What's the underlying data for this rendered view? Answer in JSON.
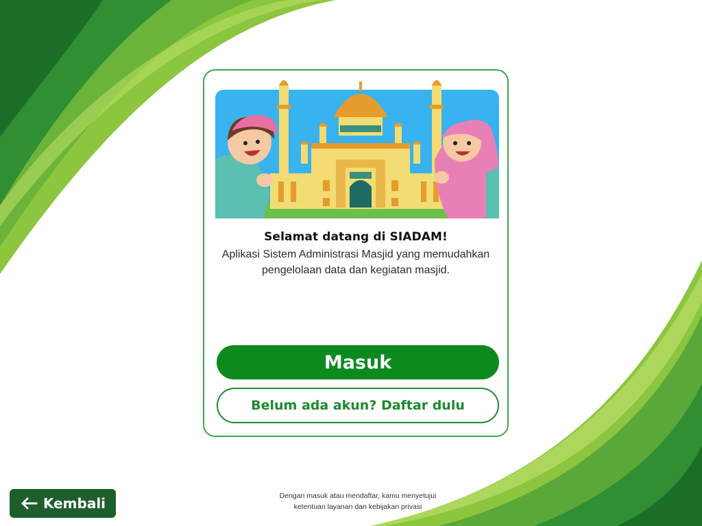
{
  "welcome": {
    "title": "Selamat datang di SIADAM!",
    "description": "Aplikasi Sistem Administrasi Masjid yang memudahkan pengelolaan data dan kegiatan masjid."
  },
  "buttons": {
    "login_label": "Masuk",
    "register_label": "Belum ada akun? Daftar dulu",
    "back_label": "Kembali"
  },
  "footer": {
    "line1": "Dengan masuk atau mendaftar, kamu menyetujui",
    "line2": "ketentuan layanan dan kebijakan privasi"
  },
  "icons": {
    "back": "arrow-left-icon",
    "hero": "mosque-illustration"
  },
  "colors": {
    "primary": "#0c8a1e",
    "secondary_text": "#1d8a2c",
    "card_border": "#3fa34d",
    "back_button": "#1e5e2c",
    "hero_sky": "#39b2f0"
  }
}
